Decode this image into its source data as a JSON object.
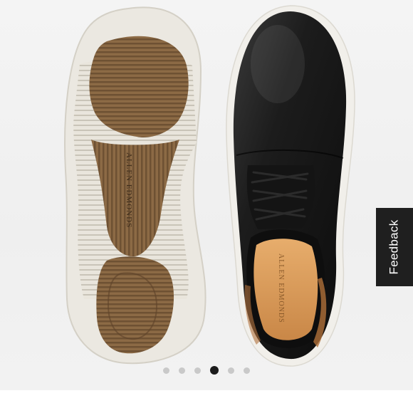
{
  "product_gallery": {
    "sole_brand_text": "ALLEN EDMONDS",
    "insole_brand_text": "ALLEN EDMONDS",
    "dots": [
      {
        "active": false
      },
      {
        "active": false
      },
      {
        "active": false
      },
      {
        "active": true
      },
      {
        "active": false
      },
      {
        "active": false
      }
    ],
    "active_index": 4,
    "total_images": 6
  },
  "feedback": {
    "label": "Feedback"
  },
  "colors": {
    "shoe_leather": "#1a1a1a",
    "sole_tread": "#8c6a45",
    "midsole": "#e8e4da",
    "insole": "#d99b58",
    "feedback_bg": "#1f1f1f"
  }
}
